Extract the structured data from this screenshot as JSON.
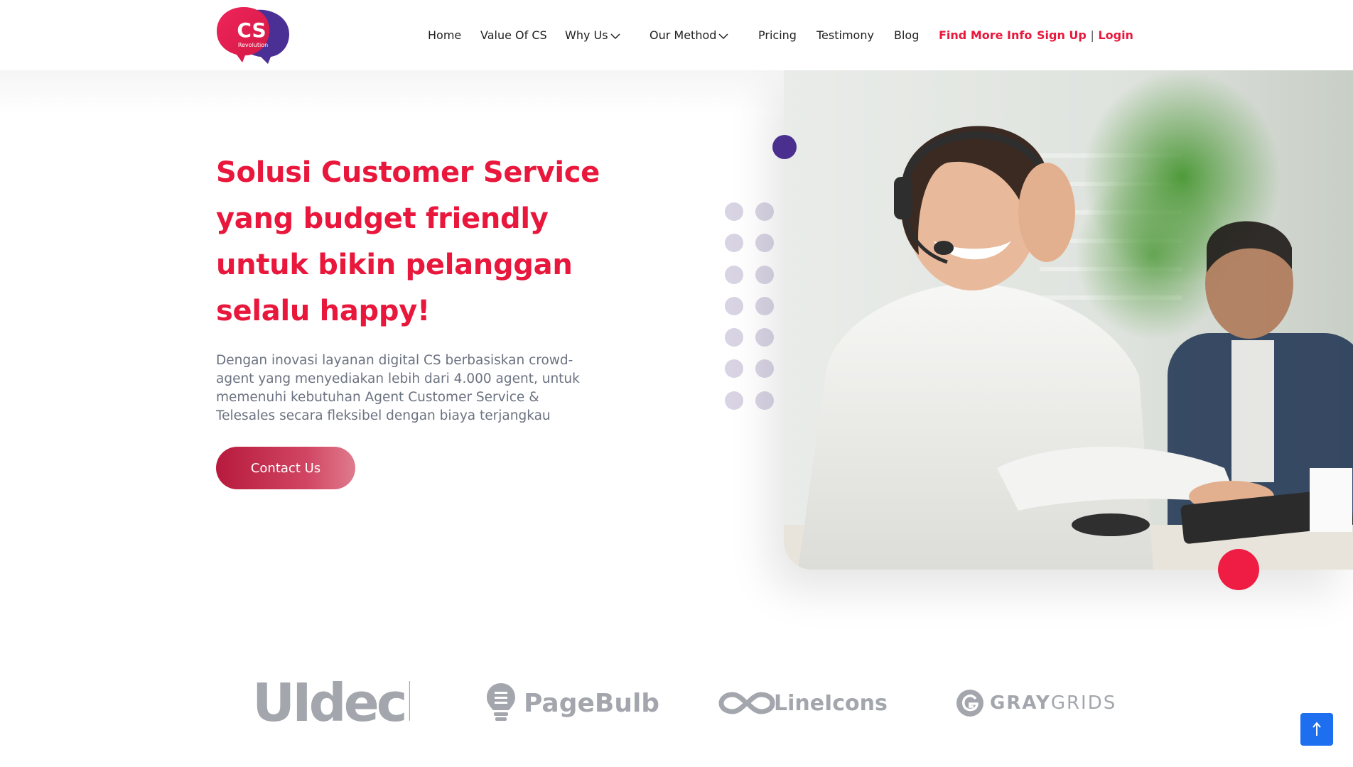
{
  "brand": {
    "logo_text": "CS",
    "logo_sub": "Revolution"
  },
  "nav": {
    "home": "Home",
    "value": "Value Of CS",
    "why": "Why Us",
    "method": "Our Method",
    "pricing": "Pricing",
    "testimony": "Testimony",
    "blog": "Blog",
    "find_more": "Find More Info",
    "sign_up": "Sign Up",
    "separator": "|",
    "login": "Login"
  },
  "hero": {
    "headline_lines": [
      "Solusi Customer Service",
      "yang budget friendly",
      "untuk bikin pelanggan",
      "selalu happy!"
    ],
    "subtext_lines": [
      "Dengan inovasi layanan digital CS berbasiskan crowd-",
      "agent yang menyediakan lebih dari 4.000 agent, untuk",
      "memenuhi kebutuhan Agent Customer Service &",
      "Telesales secara fleksibel dengan biaya terjangkau"
    ],
    "cta_label": "Contact Us"
  },
  "partners": {
    "uideck": "UIdeck",
    "pagebulb": "PageBulb",
    "lineicons": "LineIcons",
    "graygrids_a": "GRAY",
    "graygrids_b": "GRIDS"
  },
  "colors": {
    "accent": "#e8173b",
    "purple": "#4b2f8f",
    "button": "#b71a3c",
    "scroll_top": "#1e6ff0"
  },
  "icons": {
    "chevron": "chevron-down-icon",
    "scroll_top": "arrow-up-icon"
  }
}
